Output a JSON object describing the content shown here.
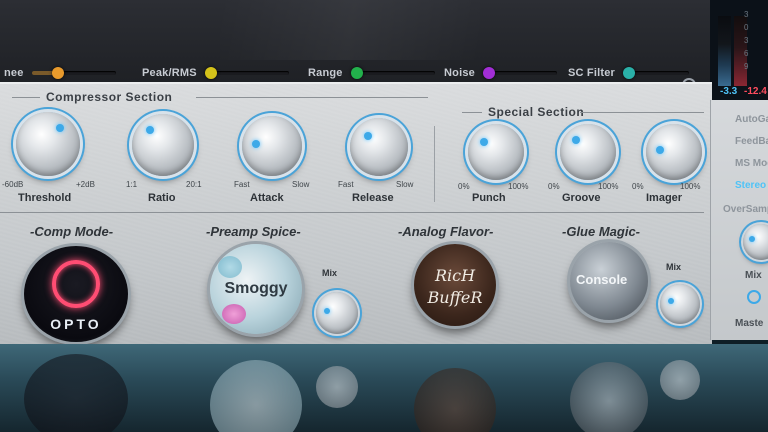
{
  "top_params": [
    {
      "label": "nee",
      "color": "#e89a2c"
    },
    {
      "label": "Peak/RMS",
      "color": "#d4c21a"
    },
    {
      "label": "Range",
      "color": "#22b14c"
    },
    {
      "label": "Noise",
      "color": "#a22ed6"
    },
    {
      "label": "SC Filter",
      "color": "#2ab0a8"
    }
  ],
  "meters": {
    "left_value": "-3.3",
    "right_value": "-12.4",
    "scale": [
      "3",
      "0",
      "3",
      "6",
      "9"
    ]
  },
  "compressor": {
    "title": "Compressor Section",
    "knobs": [
      {
        "label": "Threshold",
        "min": "-60dB",
        "max": "+2dB"
      },
      {
        "label": "Ratio",
        "min": "1:1",
        "max": "20:1"
      },
      {
        "label": "Attack",
        "min": "Fast",
        "max": "Slow"
      },
      {
        "label": "Release",
        "min": "Fast",
        "max": "Slow"
      }
    ]
  },
  "special": {
    "title": "Special Section",
    "knobs": [
      {
        "label": "Punch",
        "min": "0%",
        "max": "100%"
      },
      {
        "label": "Groove",
        "min": "0%",
        "max": "100%"
      },
      {
        "label": "Imager",
        "min": "0%",
        "max": "100%"
      }
    ]
  },
  "side_options": [
    {
      "label": "AutoGa",
      "active": false
    },
    {
      "label": "FeedBa",
      "active": false
    },
    {
      "label": "MS Mod",
      "active": false
    },
    {
      "label": "Stereo Li",
      "active": true
    },
    {
      "label": "OverSamp",
      "active": false
    }
  ],
  "side_mix_label": "Mix",
  "side_master_label": "Maste",
  "modes": {
    "comp_mode": {
      "title": "-Comp Mode-",
      "value": "OPTO"
    },
    "preamp": {
      "title": "-Preamp Spice-",
      "value": "Smoggy",
      "mix_label": "Mix"
    },
    "analog": {
      "title": "-Analog Flavor-",
      "value_line1": "RicH",
      "value_line2": "BuffeR"
    },
    "glue": {
      "title": "-Glue Magic-",
      "value": "Console",
      "mix_label": "Mix"
    }
  },
  "colors": {
    "accent": "#3da9e8",
    "active_option": "#4fc3f7",
    "meter_left": "#4fc3f7",
    "meter_right": "#ff4d5e"
  }
}
